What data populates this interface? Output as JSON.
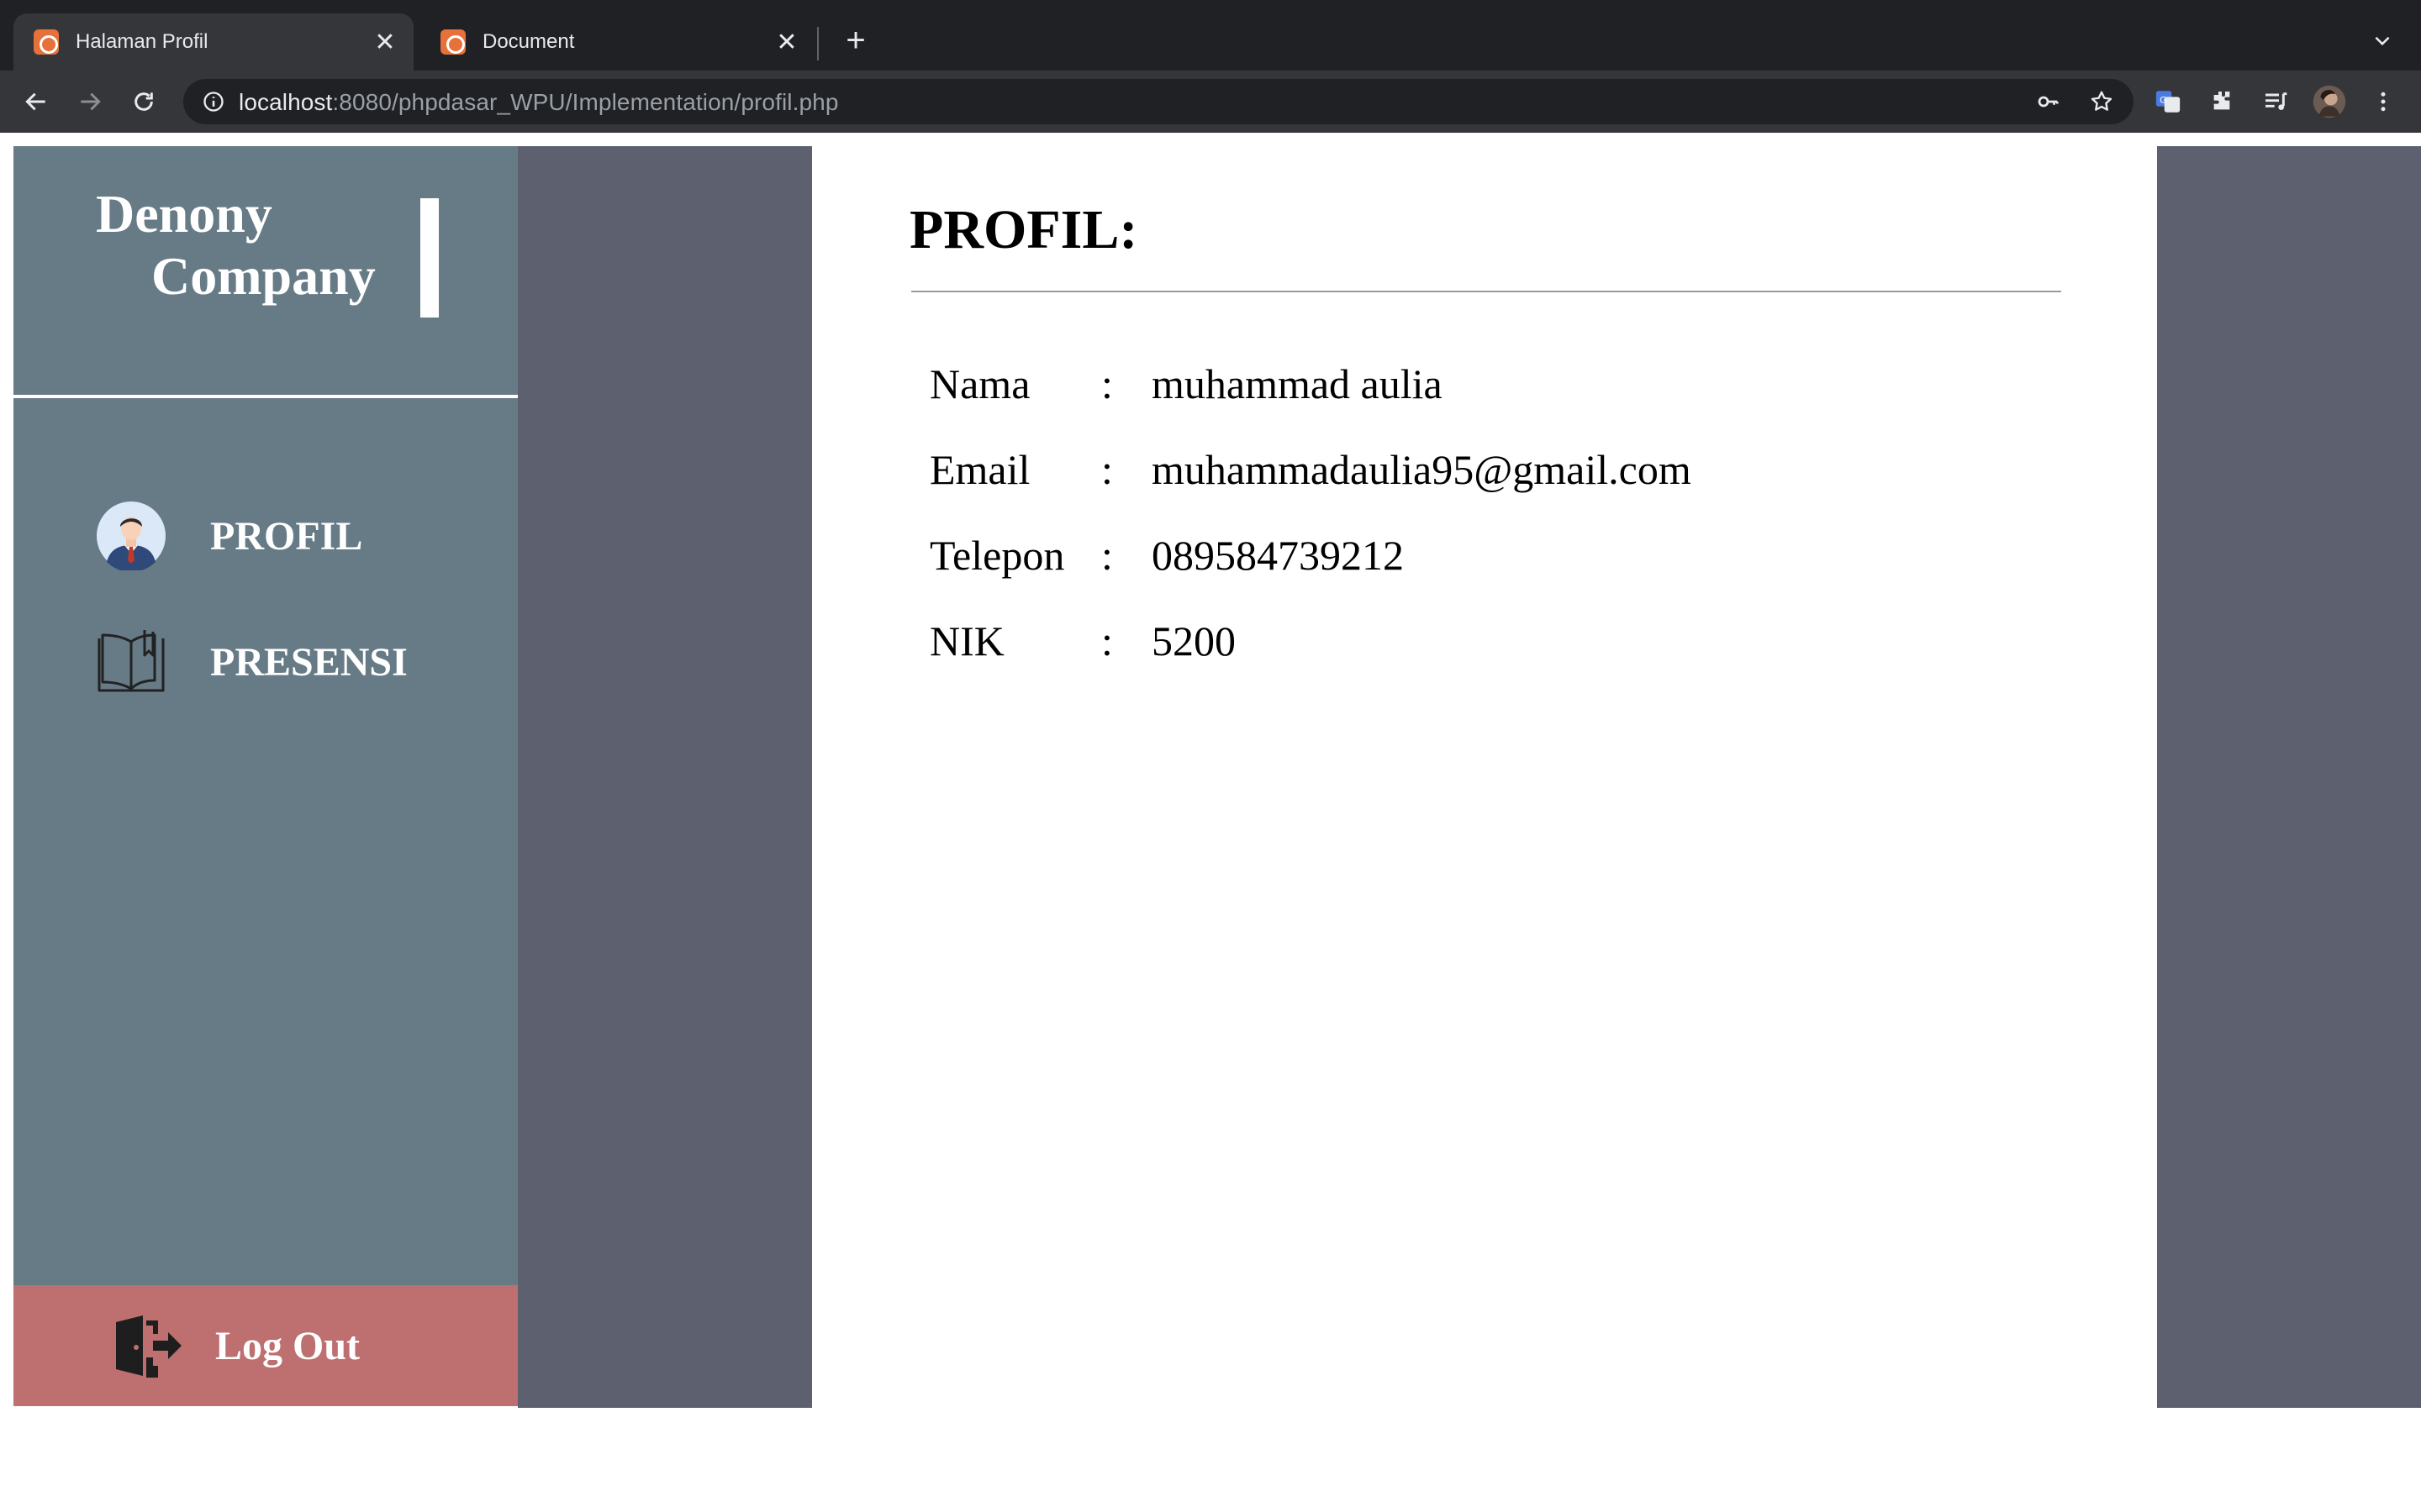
{
  "browser": {
    "tabs": [
      {
        "title": "Halaman Profil",
        "active": true
      },
      {
        "title": "Document",
        "active": false
      }
    ],
    "close_glyph": "✕",
    "newtab_glyph": "+",
    "address": {
      "host": "localhost",
      "path": ":8080/phpdasar_WPU/Implementation/profil.php"
    }
  },
  "sidebar": {
    "brand": {
      "line1": "Denony",
      "line2": "Company"
    },
    "nav": [
      {
        "label": "PROFIL",
        "icon": "user-avatar-icon"
      },
      {
        "label": "PRESENSI",
        "icon": "book-icon"
      }
    ],
    "logout": {
      "label": "Log Out",
      "icon": "logout-door-icon"
    }
  },
  "content": {
    "title": "PROFIL:",
    "separator": ":",
    "fields": [
      {
        "label": "Nama",
        "value": "muhammad aulia"
      },
      {
        "label": "Email",
        "value": "muhammadaulia95@gmail.com"
      },
      {
        "label": "Telepon",
        "value": "089584739212"
      },
      {
        "label": "NIK",
        "value": "5200"
      }
    ]
  },
  "colors": {
    "sidebar": "#677b87",
    "gutter": "#5d606e",
    "logout": "#be6f6f",
    "chrome_dark": "#202124",
    "chrome_toolbar": "#35363a"
  }
}
